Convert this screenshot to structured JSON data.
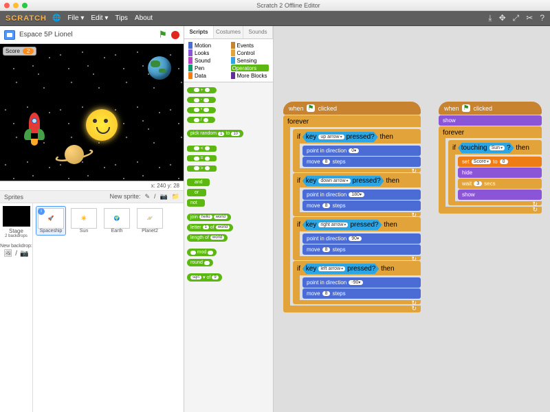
{
  "window": {
    "title": "Scratch 2 Offline Editor"
  },
  "traffic": {
    "close": "#ff5f57",
    "min": "#febc2e",
    "max": "#28c840"
  },
  "menu": {
    "logo": "SCRATCH",
    "items": [
      "🌐",
      "File ▾",
      "Edit ▾",
      "Tips",
      "About"
    ]
  },
  "tools": [
    "⤓",
    "✥",
    "⤢",
    "✂",
    "?"
  ],
  "project": {
    "title": "Espace 5P Lionel"
  },
  "stage": {
    "score_label": "Score",
    "score_value": "2",
    "coords": "x: 240  y: 28"
  },
  "sprites": {
    "header": "Sprites",
    "new_label": "New sprite:",
    "new_icons": [
      "✎",
      "/",
      "📷",
      "📁"
    ],
    "stage_label": "Stage",
    "stage_sub": "2 backdrops",
    "new_backdrop": "New backdrop:",
    "items": [
      {
        "name": "Spaceship",
        "selected": true
      },
      {
        "name": "Sun"
      },
      {
        "name": "Earth"
      },
      {
        "name": "Planet2"
      }
    ]
  },
  "tabs": [
    "Scripts",
    "Costumes",
    "Sounds"
  ],
  "categories": [
    {
      "name": "Motion",
      "color": "#4a6cd4"
    },
    {
      "name": "Events",
      "color": "#c88330"
    },
    {
      "name": "Looks",
      "color": "#8a55d7"
    },
    {
      "name": "Control",
      "color": "#e1a33a"
    },
    {
      "name": "Sound",
      "color": "#bb42c3"
    },
    {
      "name": "Sensing",
      "color": "#2ca5e2"
    },
    {
      "name": "Pen",
      "color": "#0e9a6c"
    },
    {
      "name": "Operators",
      "color": "#5cb712",
      "selected": true
    },
    {
      "name": "Data",
      "color": "#ee7d16"
    },
    {
      "name": "More Blocks",
      "color": "#632d99"
    }
  ],
  "palette": {
    "p1": "+",
    "p2": "-",
    "p3": "*",
    "p4": "/",
    "pick": "pick random",
    "to": "to",
    "pv1": "1",
    "pv2": "10",
    "lt": "<",
    "eq": "=",
    "gt": ">",
    "and": "and",
    "or": "or",
    "not": "not",
    "join": "join",
    "jv1": "hello",
    "jv2": "world",
    "letter": "letter",
    "of": "of",
    "lv": "1",
    "lw": "world",
    "length": "length of",
    "lenv": "world",
    "mod": "mod",
    "round": "round",
    "sqrt": "sqrt",
    "sof": "of",
    "sv": "9"
  },
  "script1": {
    "hat": "when",
    "hat2": "clicked",
    "forever": "forever",
    "if": "if",
    "then": "then",
    "key": "key",
    "pressed": "pressed?",
    "up": "up arrow",
    "down": "down arrow",
    "right": "right arrow",
    "left": "left arrow",
    "point": "point in direction",
    "move": "move",
    "steps": "steps",
    "d0": "0",
    "d180": "180",
    "d90": "90",
    "dm90": "-90",
    "mv": "8"
  },
  "script2": {
    "hat": "when",
    "hat2": "clicked",
    "show": "show",
    "hide": "hide",
    "forever": "forever",
    "if": "if",
    "then": "then",
    "touching": "touching",
    "sun": "Sun",
    "q": "?",
    "set": "set",
    "score": "Score",
    "to": "to",
    "zero": "0",
    "wait": "wait",
    "secs": "secs",
    "wv": "3"
  }
}
